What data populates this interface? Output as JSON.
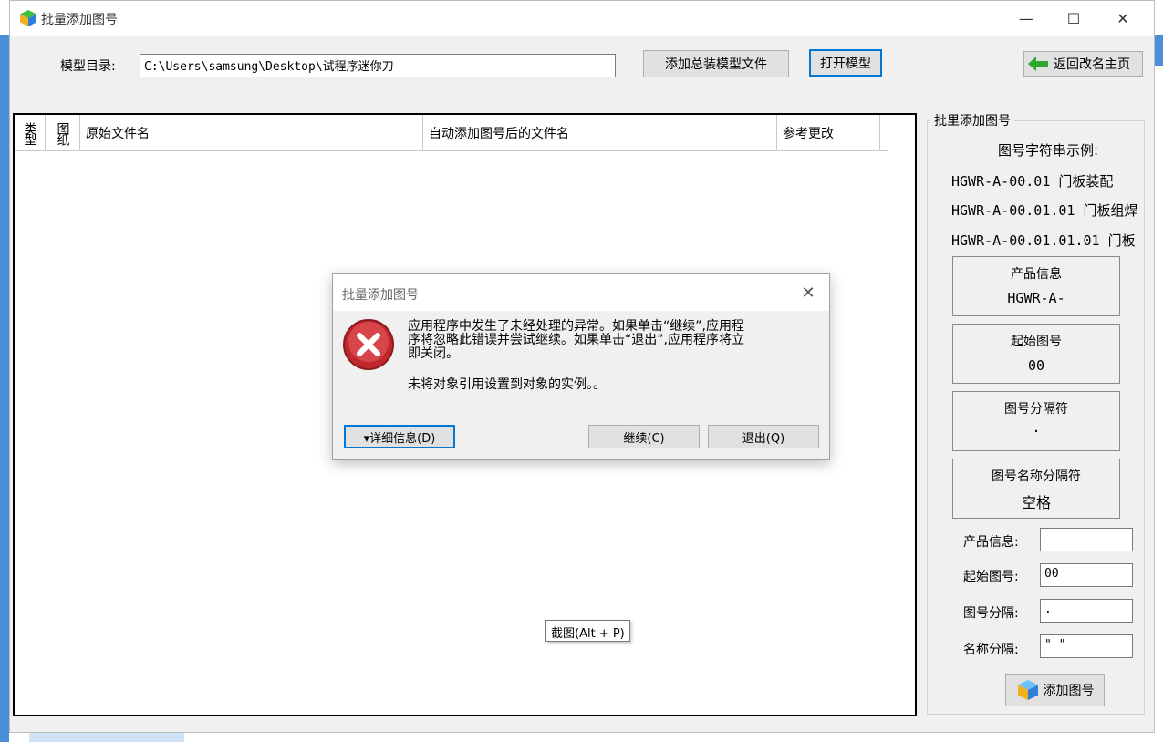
{
  "window": {
    "title": "批量添加图号",
    "minimize_glyph": "—",
    "maximize_glyph": "☐",
    "close_glyph": "✕"
  },
  "toolbar": {
    "model_dir_label": "模型目录:",
    "model_dir_value": "C:\\Users\\samsung\\Desktop\\试程序迷你刀",
    "add_assembly_button": "添加总装模型文件",
    "open_model_button": "打开模型",
    "back_button": "返回改名主页"
  },
  "grid": {
    "columns": [
      "类型",
      "图纸",
      "原始文件名",
      "自动添加图号后的文件名",
      "参考更改"
    ]
  },
  "panel": {
    "group_title": "批里添加图号",
    "example_heading": "图号字符串示例:",
    "examples": [
      "HGWR-A-00.01 门板装配",
      "HGWR-A-00.01.01 门板组焊",
      "HGWR-A-00.01.01.01 门板"
    ],
    "boxes": [
      {
        "title": "产品信息",
        "value": "HGWR-A-"
      },
      {
        "title": "起始图号",
        "value": "00"
      },
      {
        "title": "图号分隔符",
        "value": "."
      },
      {
        "title": "图号名称分隔符",
        "value": "空格"
      }
    ],
    "fields": [
      {
        "label": "产品信息:",
        "value": ""
      },
      {
        "label": "起始图号:",
        "value": "00"
      },
      {
        "label": "图号分隔:",
        "value": "."
      },
      {
        "label": "名称分隔:",
        "value": "\" \""
      }
    ],
    "add_button": "添加图号"
  },
  "dialog": {
    "title": "批量添加图号",
    "message_line1": "应用程序中发生了未经处理的异常。如果单击“继续”,应用程",
    "message_line2": "序将忽略此错误并尝试继续。如果单击“退出”,应用程序将立",
    "message_line3": "即关闭。",
    "message_detail": "未将对象引用设置到对象的实例。。",
    "details_button": "▾详细信息(D)",
    "continue_button": "继续(C)",
    "quit_button": "退出(Q)",
    "close_glyph": "✕"
  },
  "tooltip": {
    "text": "截图(Alt + P)"
  }
}
